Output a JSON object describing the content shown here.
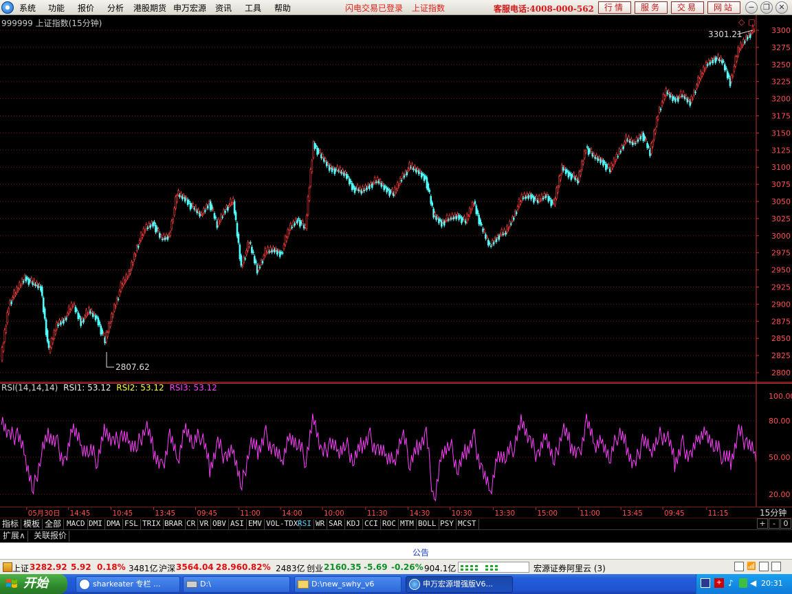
{
  "menu": {
    "items": [
      "系统",
      "功能",
      "报价",
      "分析",
      "港股期货",
      "申万宏源",
      "资讯",
      "工具",
      "帮助"
    ],
    "login_status": "闪电交易已登录",
    "current_index": "上证指数",
    "service_phone": "客服电话:4008-000-562",
    "buttons": [
      "行情",
      "服务",
      "交易",
      "网站"
    ]
  },
  "chart": {
    "title": "999999 上证指数(15分钟)",
    "high_label": "3301.21",
    "low_label": "2807.62",
    "price_ticks": [
      "3300",
      "3275",
      "3250",
      "3225",
      "3200",
      "3175",
      "3150",
      "3125",
      "3100",
      "3075",
      "3050",
      "3025",
      "3000",
      "2975",
      "2950",
      "2925",
      "2900",
      "2875",
      "2850",
      "2825",
      "2800"
    ],
    "rsi_label": "RSI(14,14,14)",
    "rsi1": "RSI1: 53.12",
    "rsi2": "RSI2: 53.12",
    "rsi3": "RSI3: 53.12",
    "rsi_ticks": [
      "100.00",
      "80.00",
      "50.00",
      "20.00"
    ],
    "time_labels": [
      "05月30日",
      "14:45",
      "10:45",
      "13:45",
      "09:45",
      "11:00",
      "14:00",
      "10:00",
      "11:30",
      "14:30",
      "10:30",
      "13:30",
      "15:00",
      "11:00",
      "13:45",
      "09:45",
      "11:15"
    ],
    "period": "15分钟",
    "colors": {
      "up": "#ff3c3c",
      "down": "#54ffff",
      "rsi": "#ff40ff",
      "grid": "#7a1a1a",
      "axis": "#c83232"
    }
  },
  "chart_data": {
    "type": "line",
    "title": "999999 上证指数(15分钟)",
    "series": [
      {
        "name": "上证指数",
        "values": [
          2818,
          2900,
          2920,
          2940,
          2930,
          2925,
          2830,
          2870,
          2880,
          2900,
          2875,
          2890,
          2880,
          2845,
          2890,
          2925,
          2945,
          2985,
          3010,
          3020,
          2995,
          3000,
          3060,
          3055,
          3040,
          3030,
          3050,
          3015,
          3040,
          3050,
          2955,
          2990,
          2950,
          2975,
          2980,
          2975,
          3010,
          3025,
          3010,
          3135,
          3115,
          3100,
          3095,
          3090,
          3070,
          3065,
          3075,
          3080,
          3070,
          3060,
          3085,
          3100,
          3095,
          3085,
          3030,
          3020,
          3025,
          3030,
          3020,
          3050,
          3010,
          2985,
          3000,
          3005,
          3030,
          3055,
          3060,
          3050,
          3060,
          3045,
          3100,
          3090,
          3080,
          3130,
          3115,
          3110,
          3095,
          3120,
          3140,
          3135,
          3150,
          3120,
          3180,
          3210,
          3200,
          3205,
          3195,
          3225,
          3250,
          3260,
          3255,
          3225,
          3270,
          3290,
          3301.21
        ]
      },
      {
        "name": "RSI1",
        "values": [
          85,
          65,
          70,
          50,
          22,
          55,
          68,
          60,
          45,
          75,
          60,
          55,
          48,
          75,
          60,
          68,
          62,
          58,
          78,
          55,
          40,
          68,
          45,
          78,
          60,
          70,
          42,
          60,
          50,
          55,
          25,
          62,
          55,
          68,
          55,
          45,
          70,
          60,
          48,
          85,
          50,
          62,
          55,
          60,
          48,
          60,
          66,
          55,
          50,
          48,
          70,
          45,
          60,
          68,
          12,
          55,
          60,
          40,
          55,
          65,
          38,
          20,
          55,
          50,
          60,
          82,
          60,
          52,
          68,
          45,
          75,
          60,
          50,
          80,
          58,
          65,
          48,
          72,
          60,
          40,
          65,
          55,
          66,
          70,
          45,
          60,
          50,
          65,
          72,
          58,
          52,
          48,
          70,
          62,
          53.12
        ]
      }
    ],
    "categories": [
      "05月30日",
      "14:45",
      "10:45",
      "13:45",
      "09:45",
      "11:00",
      "14:00",
      "10:00",
      "11:30",
      "14:30",
      "10:30",
      "13:30",
      "15:00",
      "11:00",
      "13:45",
      "09:45",
      "11:15"
    ],
    "ylim": [
      2800,
      3300
    ],
    "rsi_ylim": [
      0,
      100
    ],
    "annotations": [
      "3301.21",
      "2807.62"
    ],
    "grid": true
  },
  "indicators": {
    "left_tabs": [
      "指标",
      "模板",
      "全部"
    ],
    "tabs": [
      "MACD",
      "DMI",
      "DMA",
      "FSL",
      "TRIX",
      "BRAR",
      "CR",
      "VR",
      "OBV",
      "ASI",
      "EMV",
      "VOL-TDX",
      "RSI",
      "WR",
      "SAR",
      "KDJ",
      "CCI",
      "ROC",
      "MTM",
      "BOLL",
      "PSY",
      "MCST"
    ],
    "active": "RSI",
    "zoom": [
      "+",
      "-",
      "0"
    ]
  },
  "extension": {
    "tabs": [
      "扩展∧",
      "关联报价"
    ]
  },
  "notice": {
    "label": "公告"
  },
  "quotes": {
    "sh_label": "上证",
    "sh_value": "3282.92",
    "sh_change": "5.92",
    "sh_pct": "0.18%",
    "sh_volume": "3481亿",
    "hs_label": "沪深",
    "hs_value": "3564.04",
    "hs_change": "28.96",
    "hs_pct": "0.82%",
    "hs_volume": "2483亿",
    "cy_label": "创业",
    "cy_value": "2160.35",
    "cy_change": "-5.69",
    "cy_pct": "-0.26%",
    "cy_volume": "904.1亿",
    "server": "宏源证券阿里云 (3)"
  },
  "taskbar": {
    "start": "开始",
    "tasks": [
      "sharkeater 专栏 ...",
      "D:\\",
      "D:\\new_swhy_v6",
      "申万宏源增强版V6..."
    ],
    "clock": "20:31"
  }
}
